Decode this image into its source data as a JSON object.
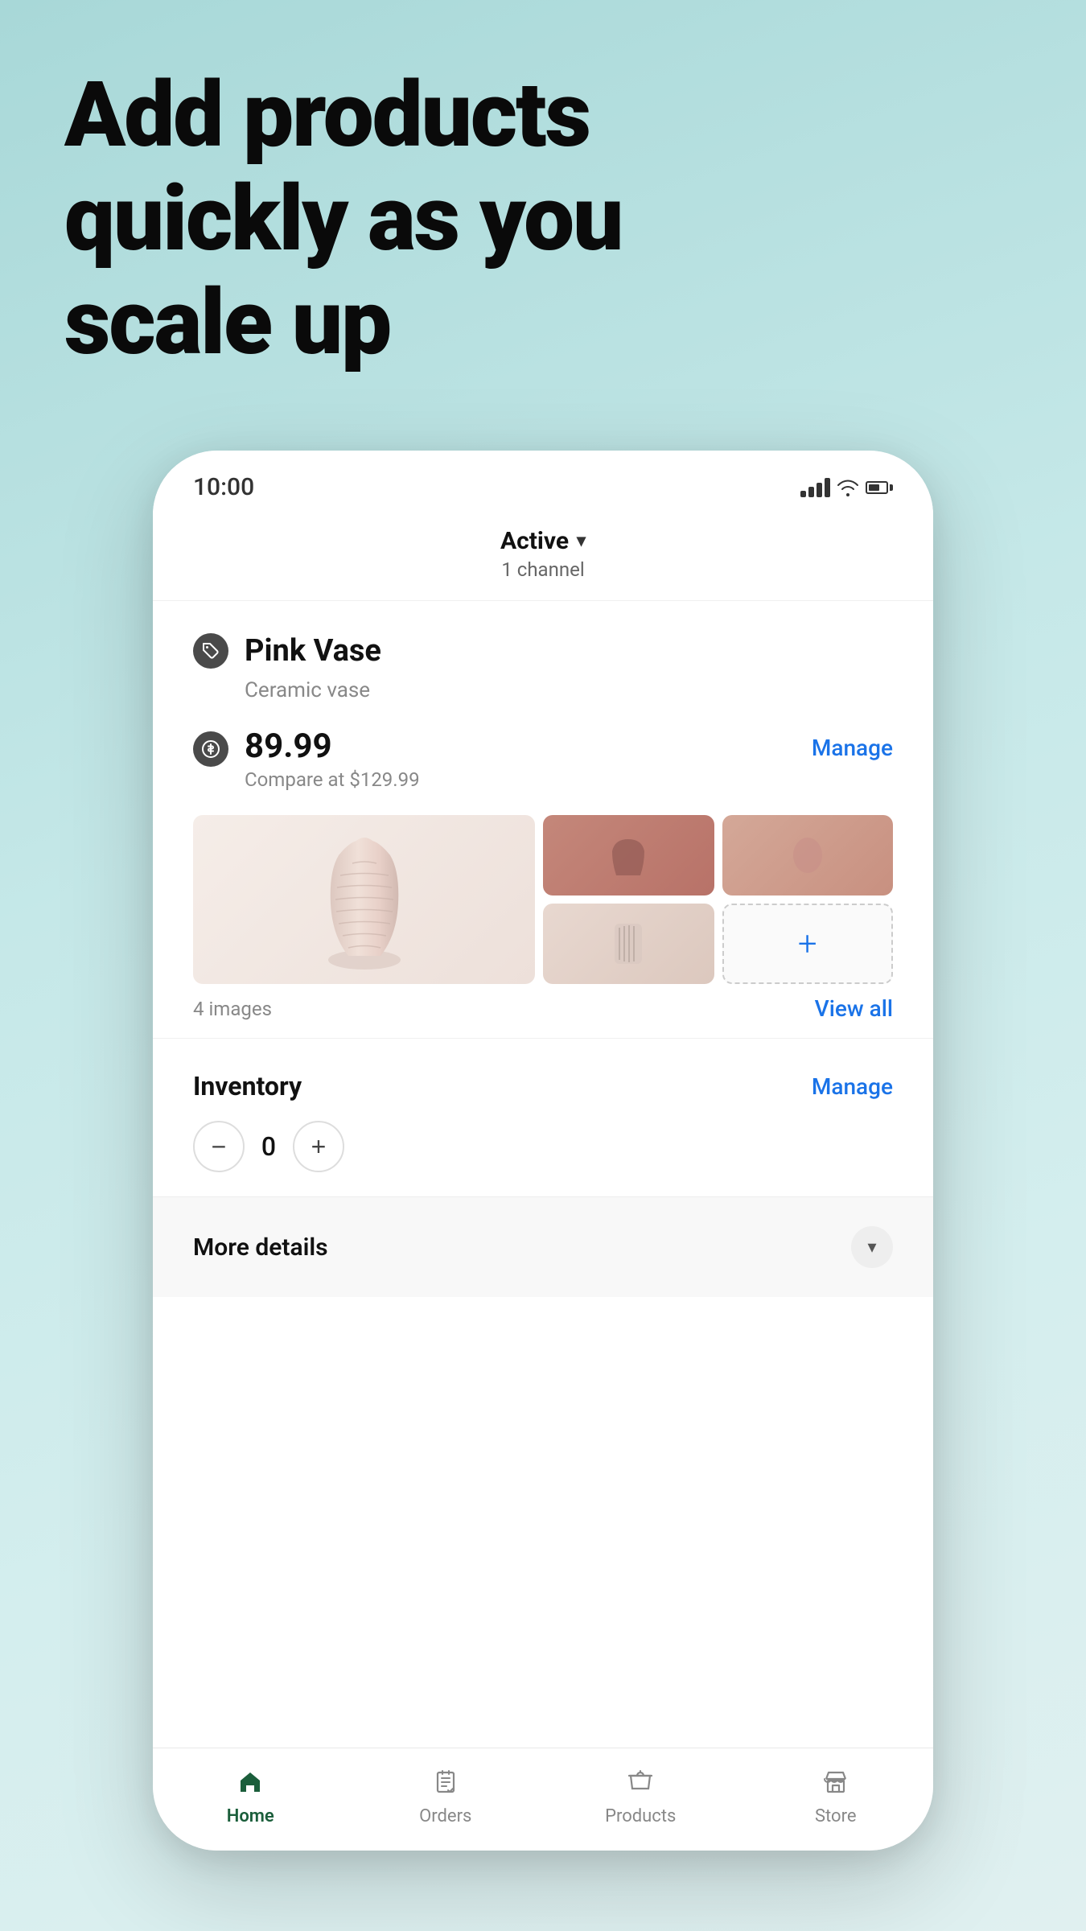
{
  "hero": {
    "title_line1": "Add products",
    "title_line2": "quickly as you",
    "title_line3": "scale up"
  },
  "status_bar": {
    "time": "10:00"
  },
  "header": {
    "status": "Active",
    "channel_count": "1 channel"
  },
  "product": {
    "name": "Pink Vase",
    "type": "Ceramic vase",
    "price": "89.99",
    "compare_price": "Compare at $129.99",
    "manage_label": "Manage",
    "image_count": "4 images",
    "view_all_label": "View all"
  },
  "inventory": {
    "label": "Inventory",
    "manage_label": "Manage",
    "quantity": "0"
  },
  "more_details": {
    "label": "More details"
  },
  "bottom_nav": {
    "home": "Home",
    "orders": "Orders",
    "products": "Products",
    "store": "Store"
  }
}
